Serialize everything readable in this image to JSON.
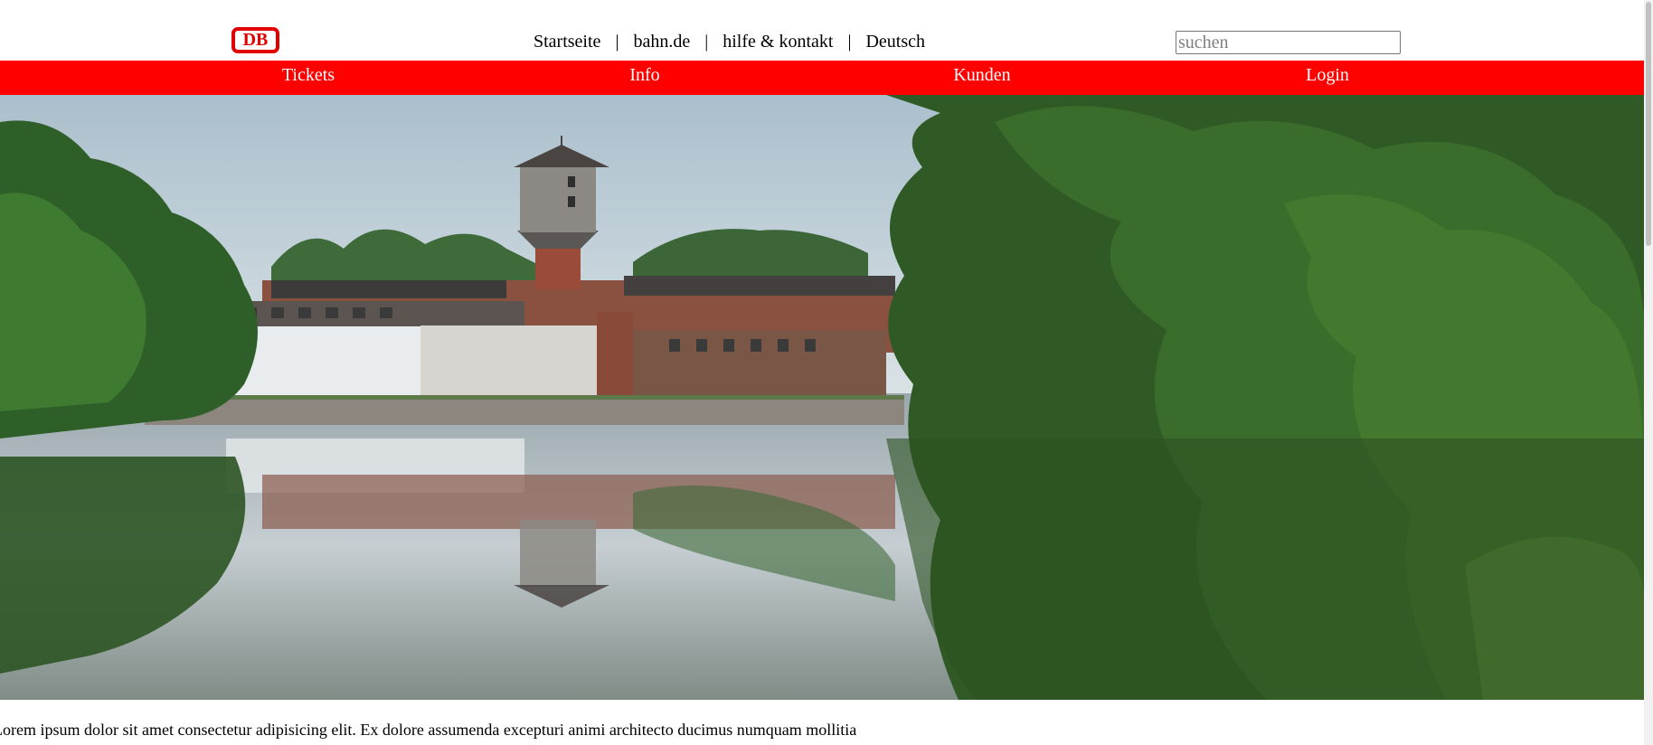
{
  "header": {
    "logo_text": "DB",
    "links": [
      {
        "label": "Startseite"
      },
      {
        "label": "bahn.de"
      },
      {
        "label": "hilfe & kontakt"
      },
      {
        "label": "Deutsch"
      }
    ],
    "separator": "|",
    "search_placeholder": "suchen"
  },
  "nav": {
    "items": [
      {
        "label": "Tickets"
      },
      {
        "label": "Info"
      },
      {
        "label": "Kunden"
      },
      {
        "label": "Login"
      }
    ]
  },
  "hero": {
    "image_subject": "water-tower-lake-reflection"
  },
  "content": {
    "intro_text": "Lorem ipsum dolor sit amet consectetur adipisicing elit. Ex dolore assumenda excepturi animi architecto ducimus numquam mollitia"
  },
  "colors": {
    "brand_red": "#ff0000",
    "logo_red": "#e10000"
  }
}
